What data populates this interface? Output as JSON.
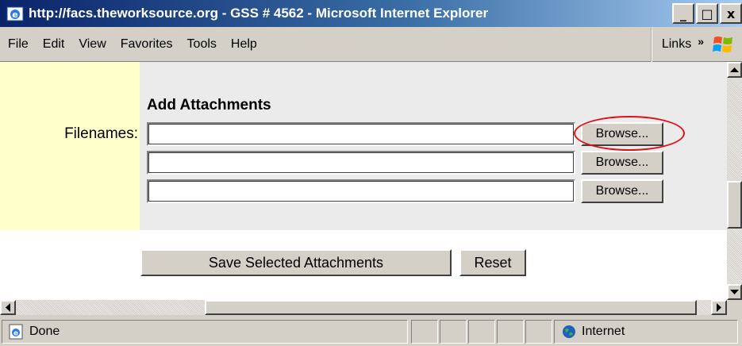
{
  "window": {
    "title": "http://facs.theworksource.org - GSS # 4562 - Microsoft Internet Explorer",
    "buttons": {
      "minimize": "_",
      "maximize": "□",
      "close": "x"
    }
  },
  "menubar": {
    "items": [
      {
        "label": "File"
      },
      {
        "label": "Edit"
      },
      {
        "label": "View"
      },
      {
        "label": "Favorites"
      },
      {
        "label": "Tools"
      },
      {
        "label": "Help"
      }
    ],
    "links_label": "Links",
    "links_chevron": "»"
  },
  "form": {
    "section_title": "Add Attachments",
    "filenames_label": "Filenames:",
    "file_inputs": [
      {
        "value": "",
        "browse_label": "Browse..."
      },
      {
        "value": "",
        "browse_label": "Browse..."
      },
      {
        "value": "",
        "browse_label": "Browse..."
      }
    ],
    "save_button_label": "Save Selected Attachments",
    "reset_button_label": "Reset"
  },
  "statusbar": {
    "status_text": "Done",
    "zone_text": "Internet"
  },
  "colors": {
    "titlebar_start": "#0a246a",
    "label_column_bg": "#ffffcc",
    "form_bg": "#ebebeb",
    "highlight": "#e0101a"
  },
  "icons": [
    "ie-app-icon",
    "windows-logo-icon",
    "ie-page-icon",
    "globe-icon",
    "scroll-up-icon",
    "scroll-down-icon",
    "scroll-left-icon",
    "scroll-right-icon"
  ]
}
